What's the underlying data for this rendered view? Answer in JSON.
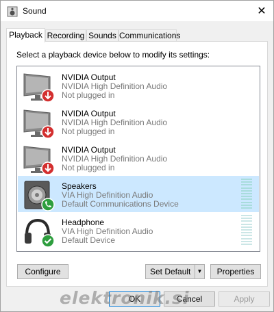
{
  "window": {
    "title": "Sound",
    "close_label": "✕"
  },
  "tabs": [
    {
      "label": "Playback",
      "active": true
    },
    {
      "label": "Recording",
      "active": false
    },
    {
      "label": "Sounds",
      "active": false
    },
    {
      "label": "Communications",
      "active": false
    }
  ],
  "panel": {
    "instruction": "Select a playback device below to modify its settings:"
  },
  "devices": [
    {
      "name": "NVIDIA Output",
      "driver": "NVIDIA High Definition Audio",
      "status": "Not plugged in",
      "icon": "monitor-icon",
      "badge": "unplugged-badge-icon"
    },
    {
      "name": "NVIDIA Output",
      "driver": "NVIDIA High Definition Audio",
      "status": "Not plugged in",
      "icon": "monitor-icon",
      "badge": "unplugged-badge-icon"
    },
    {
      "name": "NVIDIA Output",
      "driver": "NVIDIA High Definition Audio",
      "status": "Not plugged in",
      "icon": "monitor-icon",
      "badge": "unplugged-badge-icon"
    },
    {
      "name": "Speakers",
      "driver": "VIA High Definition Audio",
      "status": "Default Communications Device",
      "icon": "speaker-icon",
      "badge": "phone-badge-icon",
      "selected": true
    },
    {
      "name": "Headphone",
      "driver": "VIA High Definition Audio",
      "status": "Default Device",
      "icon": "headphone-icon",
      "badge": "default-check-badge-icon"
    }
  ],
  "buttons": {
    "configure": "Configure",
    "set_default": "Set Default",
    "set_default_arrow": "▼",
    "properties": "Properties",
    "ok": "OK",
    "cancel": "Cancel",
    "apply": "Apply"
  },
  "watermark": "elektronik.si",
  "colors": {
    "selection": "#cce8ff",
    "unplugged": "#d32f2f",
    "default_green": "#2e9e3e",
    "meter": "#a8dcdc"
  }
}
